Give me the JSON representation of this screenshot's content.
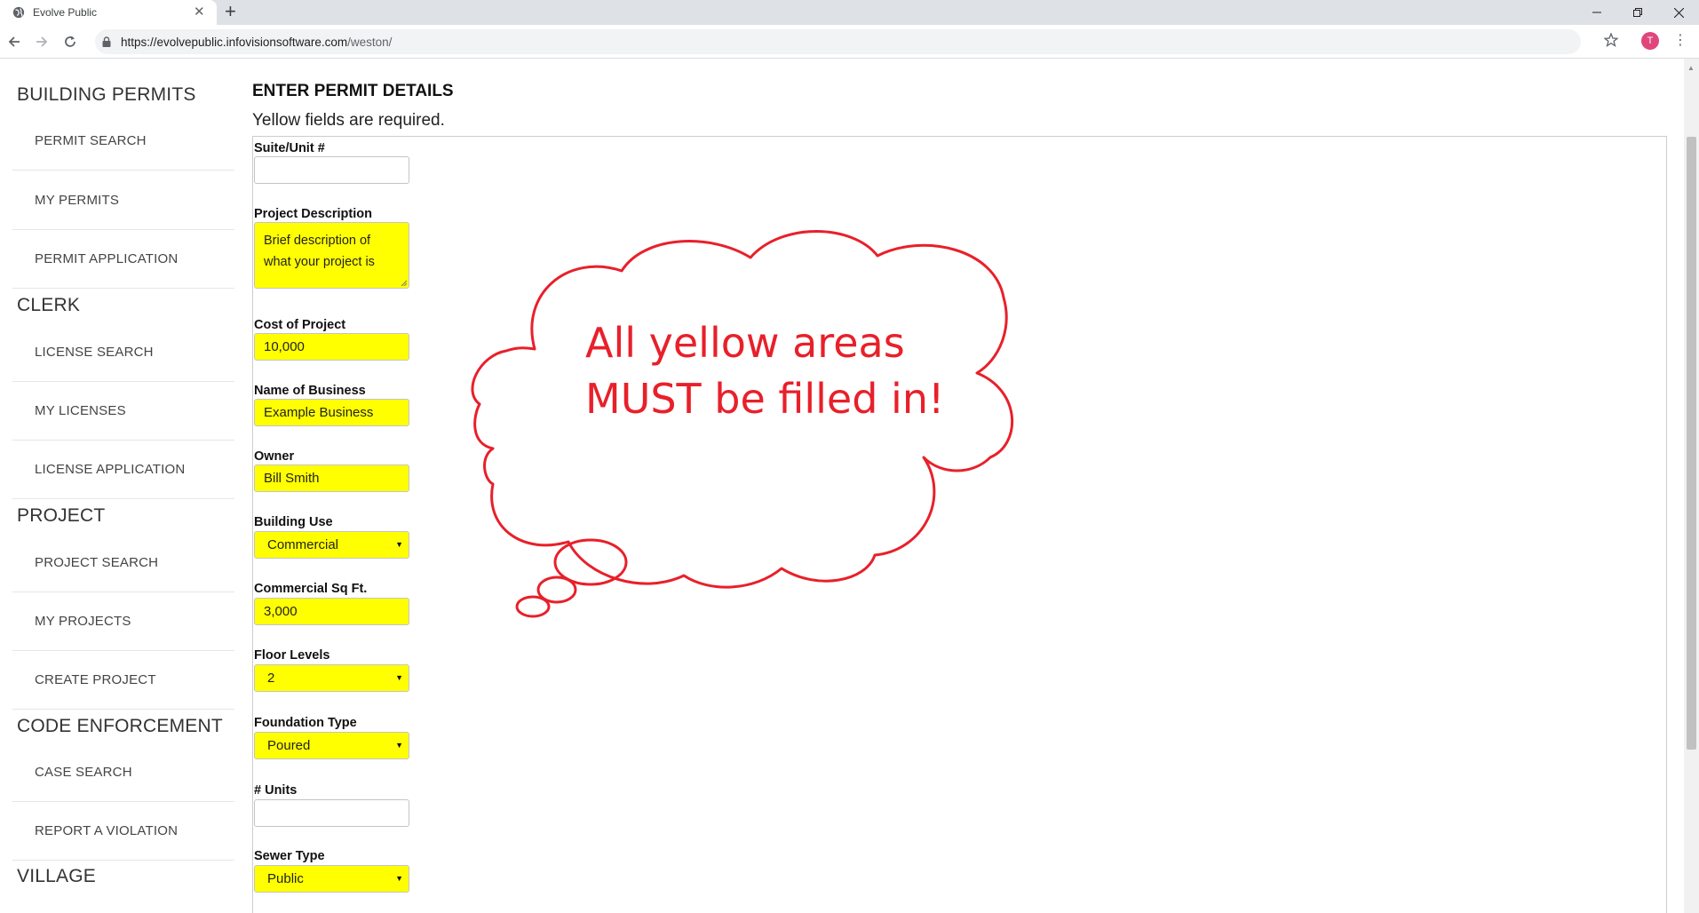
{
  "browser": {
    "tab_title": "Evolve Public",
    "url_host": "https://evolvepublic.infovisionsoftware.com",
    "url_path": "/weston/",
    "profile_initial": "T"
  },
  "sidebar": {
    "sections": [
      {
        "title": "BUILDING PERMITS",
        "items": [
          "PERMIT SEARCH",
          "MY PERMITS",
          "PERMIT APPLICATION"
        ]
      },
      {
        "title": "CLERK",
        "items": [
          "LICENSE SEARCH",
          "MY LICENSES",
          "LICENSE APPLICATION"
        ]
      },
      {
        "title": "PROJECT",
        "items": [
          "PROJECT SEARCH",
          "MY PROJECTS",
          "CREATE PROJECT"
        ]
      },
      {
        "title": "CODE ENFORCEMENT",
        "items": [
          "CASE SEARCH",
          "REPORT A VIOLATION"
        ]
      },
      {
        "title": "VILLAGE",
        "items": []
      }
    ]
  },
  "form": {
    "title": "ENTER PERMIT DETAILS",
    "subtitle": "Yellow fields are required.",
    "fields": [
      {
        "label": "Suite/Unit #",
        "value": "",
        "required": false,
        "kind": "text"
      },
      {
        "label": "Project Description",
        "value": "Brief description of what your project is",
        "line1": "Brief description of",
        "line2": "what your project is",
        "required": true,
        "kind": "textarea"
      },
      {
        "label": "Cost of Project",
        "value": "10,000",
        "required": true,
        "kind": "text"
      },
      {
        "label": "Name of Business",
        "value": "Example Business",
        "required": true,
        "kind": "text"
      },
      {
        "label": "Owner",
        "value": "Bill Smith",
        "required": true,
        "kind": "text"
      },
      {
        "label": "Building Use",
        "value": "Commercial",
        "required": true,
        "kind": "select"
      },
      {
        "label": "Commercial Sq Ft.",
        "value": "3,000",
        "required": true,
        "kind": "text"
      },
      {
        "label": "Floor Levels",
        "value": "2",
        "required": true,
        "kind": "select"
      },
      {
        "label": "Foundation Type",
        "value": "Poured",
        "required": true,
        "kind": "select"
      },
      {
        "label": "# Units",
        "value": "",
        "required": false,
        "kind": "text"
      },
      {
        "label": "Sewer Type",
        "value": "Public",
        "required": true,
        "kind": "select"
      }
    ]
  },
  "annotation": {
    "line1": "All yellow areas",
    "line2": "MUST be filled in!",
    "color": "#e8202a"
  },
  "colors": {
    "required_field": "#ffff00",
    "annotation": "#e8202a",
    "avatar": "#e0457b"
  }
}
